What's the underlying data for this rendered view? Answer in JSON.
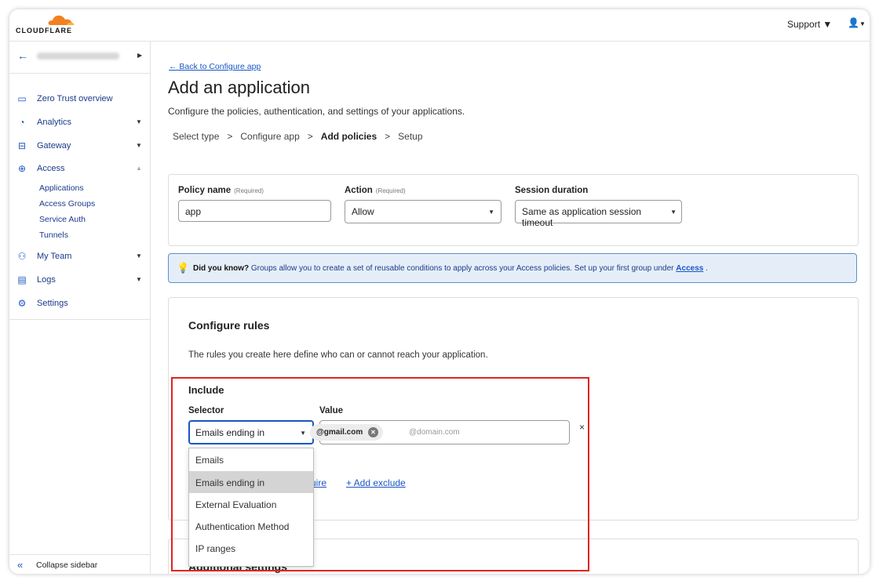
{
  "brand": {
    "name": "CLOUDFLARE",
    "accent": "#f38020"
  },
  "topbar": {
    "support_label": "Support",
    "user_icon": "user-icon"
  },
  "sidebar": {
    "items": [
      {
        "label": "Zero Trust overview",
        "icon": "dashboard-icon"
      },
      {
        "label": "Analytics",
        "icon": "pie-chart-icon"
      },
      {
        "label": "Gateway",
        "icon": "gateway-icon"
      },
      {
        "label": "Access",
        "icon": "access-icon"
      },
      {
        "label": "My Team",
        "icon": "team-icon"
      },
      {
        "label": "Logs",
        "icon": "logs-icon"
      },
      {
        "label": "Settings",
        "icon": "gear-icon"
      }
    ],
    "access_sub": [
      "Applications",
      "Access Groups",
      "Service Auth",
      "Tunnels"
    ],
    "collapse_label": "Collapse sidebar"
  },
  "page": {
    "back_link": "← Back to Configure app",
    "title": "Add an application",
    "description": "Configure the policies, authentication, and settings of your applications.",
    "steps": [
      "Select type",
      "Configure app",
      "Add policies",
      "Setup"
    ],
    "current_step": "Add policies"
  },
  "policy": {
    "name_label": "Policy name",
    "name_required": "(Required)",
    "name_value": "app",
    "action_label": "Action",
    "action_required": "(Required)",
    "action_value": "Allow",
    "session_label": "Session duration",
    "session_value": "Same as application session timeout"
  },
  "info": {
    "lead": "Did you know?",
    "text": "Groups allow you to create a set of reusable conditions to apply across your Access policies. Set up your first group under",
    "link": "Access",
    "end": "."
  },
  "rules": {
    "title": "Configure rules",
    "description": "The rules you create here define who can or cannot reach your application.",
    "include_title": "Include",
    "selector_label": "Selector",
    "value_label": "Value",
    "selector_value": "Emails ending in",
    "tag_value": "@gmail.com",
    "value_placeholder": "@domain.com",
    "require_link_partial": "uire",
    "exclude_link": "+ Add exclude",
    "options": [
      "Emails",
      "Emails ending in",
      "External Evaluation",
      "Authentication Method",
      "IP ranges"
    ],
    "selected_option": "Emails ending in"
  },
  "additional": {
    "title": "Additional settings"
  }
}
